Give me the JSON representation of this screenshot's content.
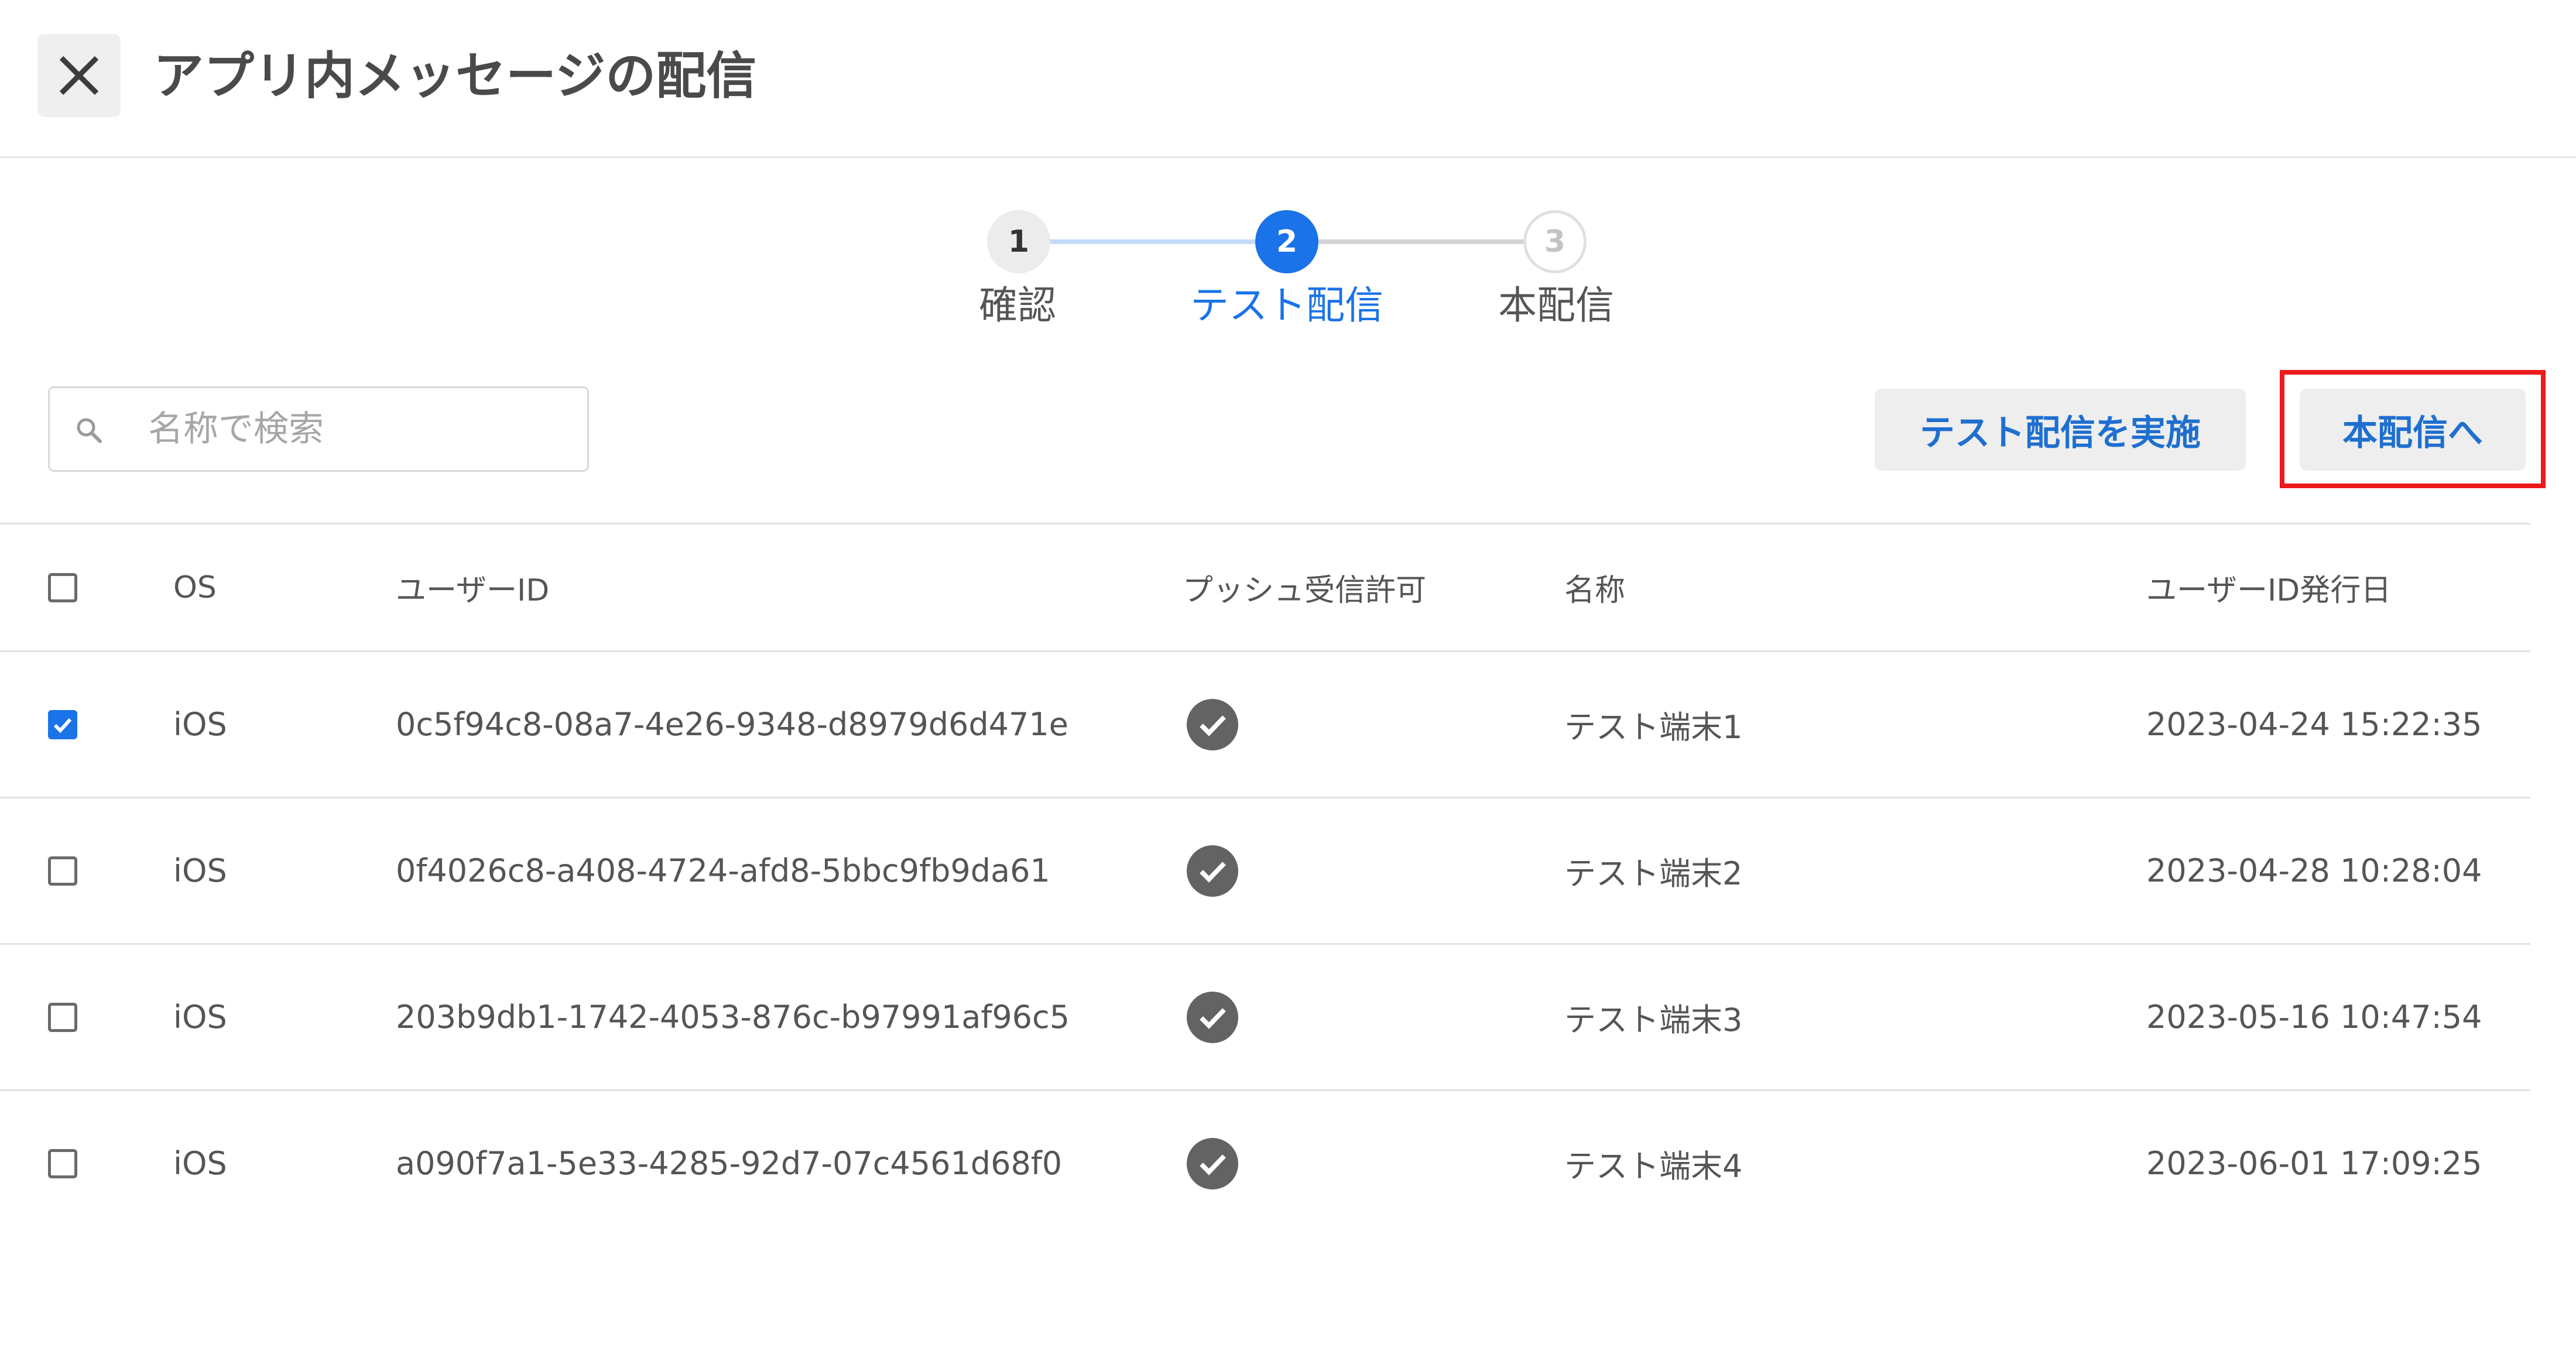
{
  "header": {
    "title": "アプリ内メッセージの配信",
    "close_icon": "close-icon"
  },
  "stepper": {
    "current_step": 2,
    "steps": [
      {
        "number": "1",
        "label": "確認",
        "state": "completed"
      },
      {
        "number": "2",
        "label": "テスト配信",
        "state": "active"
      },
      {
        "number": "3",
        "label": "本配信",
        "state": "pending"
      }
    ]
  },
  "search": {
    "placeholder": "名称で検索",
    "value": "",
    "icon": "search-icon"
  },
  "toolbar": {
    "test_send_label": "テスト配信を実施",
    "next_label": "本配信へ"
  },
  "table": {
    "columns": [
      "OS",
      "ユーザーID",
      "プッシュ受信許可",
      "名称",
      "ユーザーID発行日"
    ],
    "rows": [
      {
        "checked": true,
        "os": "iOS",
        "user_id": "0c5f94c8-08a7-4e26-9348-d8979d6d471e",
        "push_allowed": true,
        "name": "テスト端末1",
        "issued": "2023-04-24 15:22:35"
      },
      {
        "checked": false,
        "os": "iOS",
        "user_id": "0f4026c8-a408-4724-afd8-5bbc9fb9da61",
        "push_allowed": true,
        "name": "テスト端末2",
        "issued": "2023-04-28 10:28:04"
      },
      {
        "checked": false,
        "os": "iOS",
        "user_id": "203b9db1-1742-4053-876c-b97991af96c5",
        "push_allowed": true,
        "name": "テスト端末3",
        "issued": "2023-05-16 10:47:54"
      },
      {
        "checked": false,
        "os": "iOS",
        "user_id": "a090f7a1-5e33-4285-92d7-07c4561d68f0",
        "push_allowed": true,
        "name": "テスト端末4",
        "issued": "2023-06-01 17:09:25"
      }
    ]
  },
  "colors": {
    "accent": "#1a73e8",
    "link_text": "#1e6fd0",
    "highlight": "#ec1b1b",
    "check_circle": "#636363"
  }
}
